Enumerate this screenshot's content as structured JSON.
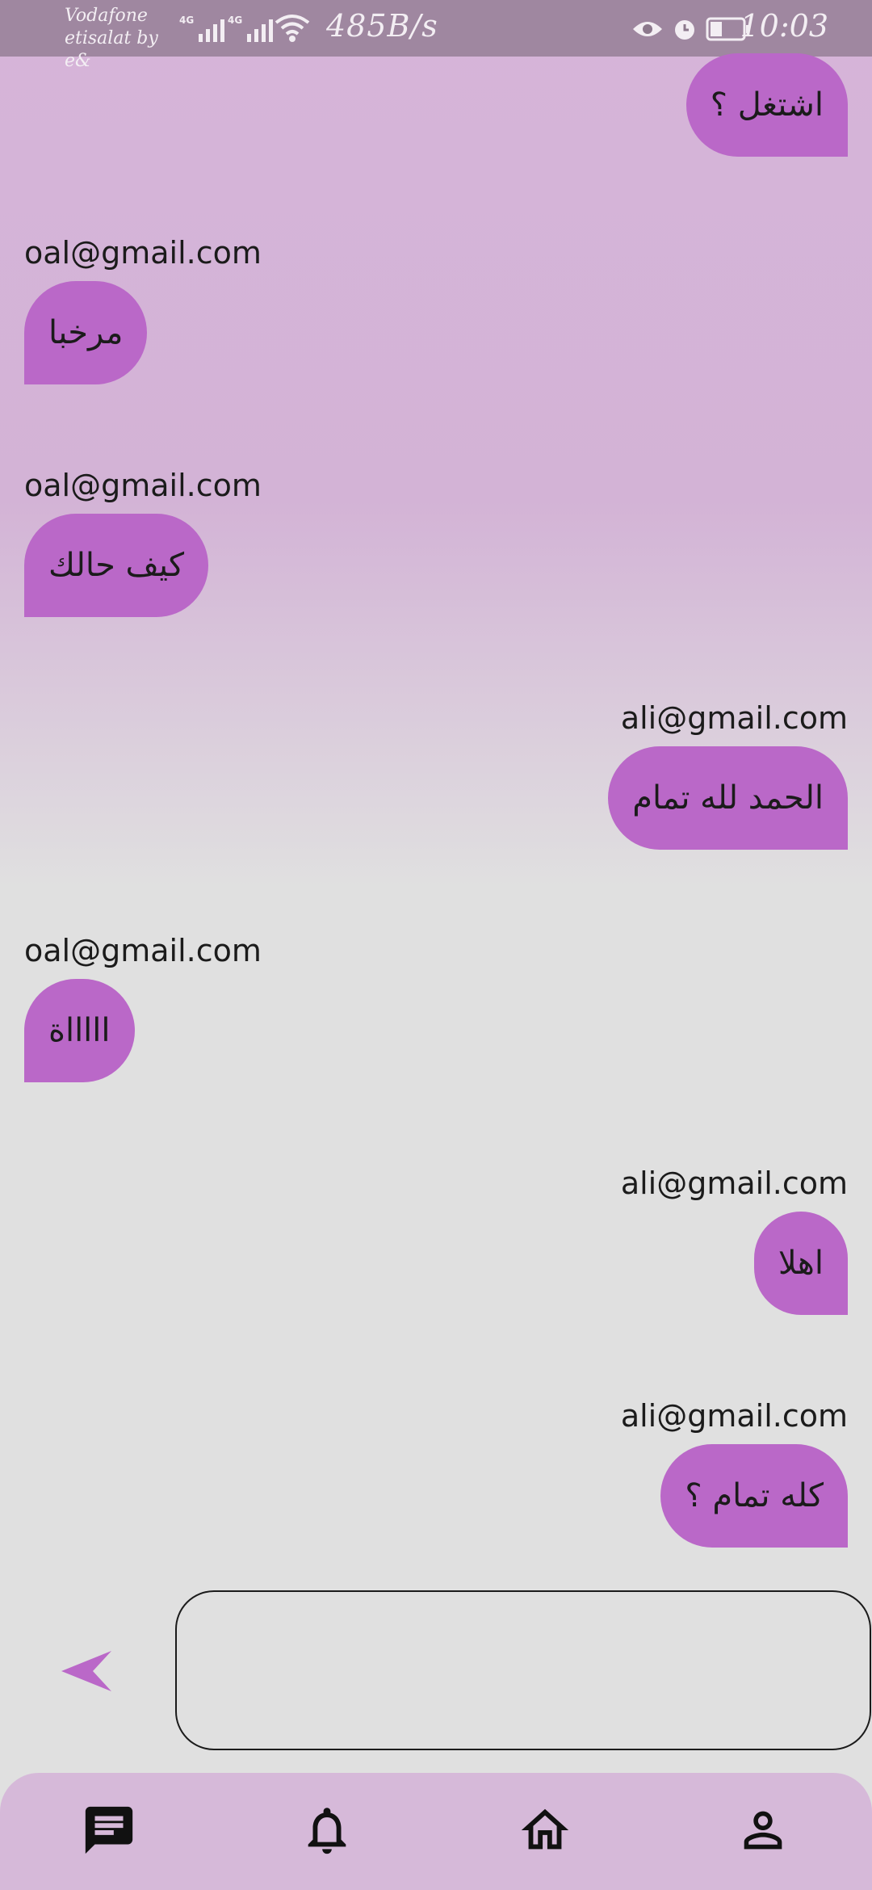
{
  "status_bar": {
    "carrier_line1": "Vodafone",
    "carrier_line2": "etisalat by e&",
    "network_tag_1": "4G",
    "network_tag_2": "4G",
    "net_speed": "485B/s",
    "time": "10:03"
  },
  "messages": [
    {
      "side": "right",
      "sender": "",
      "text": "اشتغل ؟"
    },
    {
      "side": "left",
      "sender": "oal@gmail.com",
      "text": "مرخبا"
    },
    {
      "side": "left",
      "sender": "oal@gmail.com",
      "text": "كيف حالك"
    },
    {
      "side": "right",
      "sender": "ali@gmail.com",
      "text": "الحمد لله تمام"
    },
    {
      "side": "left",
      "sender": "oal@gmail.com",
      "text": "اااااة"
    },
    {
      "side": "right",
      "sender": "ali@gmail.com",
      "text": "اهلا"
    },
    {
      "side": "right",
      "sender": "ali@gmail.com",
      "text": "كله تمام ؟"
    }
  ],
  "composer": {
    "input_value": "",
    "send_icon": "send-icon"
  },
  "bottom_nav": [
    {
      "icon": "chat-icon",
      "active": true
    },
    {
      "icon": "bell-icon",
      "active": false
    },
    {
      "icon": "home-icon",
      "active": false
    },
    {
      "icon": "profile-icon",
      "active": false
    }
  ],
  "colors": {
    "bubble": "#ba68c8",
    "send_icon": "#ba68c8",
    "nav_background": "#d6b9d9",
    "top_background": "#d6b4d9",
    "bottom_background": "#e0e0e0"
  }
}
